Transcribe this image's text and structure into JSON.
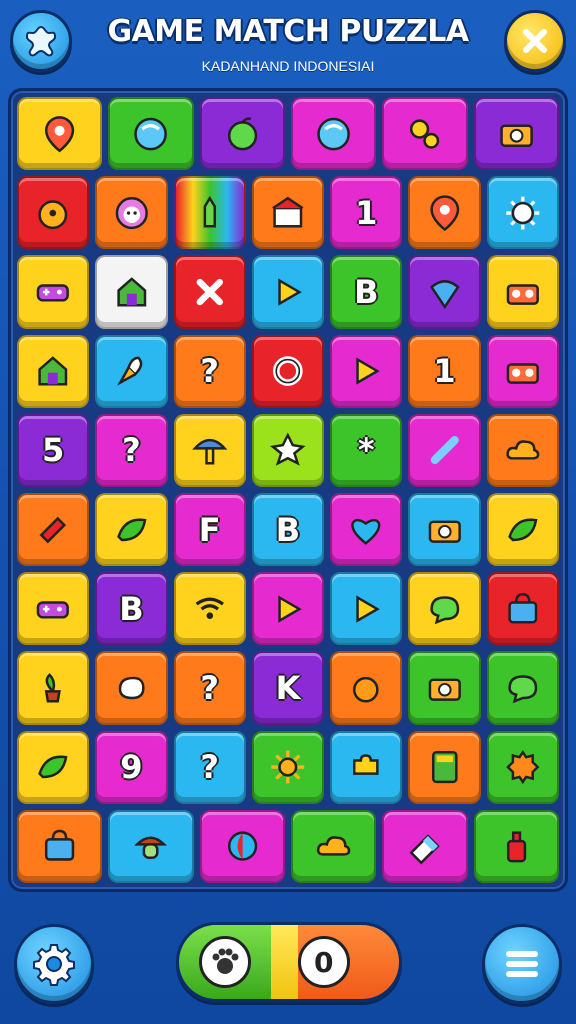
{
  "header": {
    "title": "GAME MATCH PUZZLA",
    "subtitle": "KADANHAND INDONESIAI",
    "left_button_icon": "star-puzzle-icon",
    "right_button_icon": "close-icon"
  },
  "colors": {
    "background": "#1552b0",
    "board": "#173a82",
    "yellow": "#ffd21e",
    "green": "#3cc42a",
    "purple": "#8a2bd6",
    "magenta": "#e52bd0",
    "red": "#e8232a",
    "orange": "#ff7a1a",
    "cyan": "#2bb8f0",
    "lime": "#9be21d",
    "white": "#f4f4f4"
  },
  "board": {
    "rows": [
      [
        {
          "color": "yellow",
          "icon": "location-pin-icon"
        },
        {
          "color": "green",
          "icon": "blue-ball-icon"
        },
        {
          "color": "purple",
          "icon": "green-apple-icon"
        },
        {
          "color": "magenta",
          "icon": "blue-ball-icon"
        },
        {
          "color": "magenta",
          "icon": "key-ring-icon"
        },
        {
          "color": "purple",
          "icon": "camera-icon"
        }
      ],
      [
        {
          "color": "red",
          "icon": "orange-monster-icon"
        },
        {
          "color": "orange",
          "icon": "flower-face-icon"
        },
        {
          "color": "rainbow",
          "icon": "pencil-icon"
        },
        {
          "color": "orange",
          "icon": "shop-icon"
        },
        {
          "color": "magenta",
          "icon": "letter-icon",
          "glyph": "1"
        },
        {
          "color": "orange",
          "icon": "location-pin-icon"
        },
        {
          "color": "cyan",
          "icon": "sun-face-icon"
        }
      ],
      [
        {
          "color": "yellow",
          "icon": "gamepad-icon"
        },
        {
          "color": "white",
          "icon": "house-icon"
        },
        {
          "color": "red",
          "icon": "close-icon"
        },
        {
          "color": "cyan",
          "icon": "play-icon"
        },
        {
          "color": "green",
          "icon": "letter-icon",
          "glyph": "B"
        },
        {
          "color": "purple",
          "icon": "spinning-top-icon"
        },
        {
          "color": "yellow",
          "icon": "radio-icon"
        }
      ],
      [
        {
          "color": "yellow",
          "icon": "house-icon"
        },
        {
          "color": "cyan",
          "icon": "rocket-icon"
        },
        {
          "color": "orange",
          "icon": "question-icon",
          "glyph": "?"
        },
        {
          "color": "red",
          "icon": "ring-icon"
        },
        {
          "color": "magenta",
          "icon": "play-icon"
        },
        {
          "color": "orange",
          "icon": "letter-icon",
          "glyph": "1"
        },
        {
          "color": "magenta",
          "icon": "radio-icon"
        }
      ],
      [
        {
          "color": "purple",
          "icon": "number-icon",
          "glyph": "5"
        },
        {
          "color": "magenta",
          "icon": "question-icon",
          "glyph": "?"
        },
        {
          "color": "yellow",
          "icon": "mushroom-icon"
        },
        {
          "color": "lime",
          "icon": "puzzle-star-icon"
        },
        {
          "color": "green",
          "icon": "asterisk-icon",
          "glyph": "*"
        },
        {
          "color": "magenta",
          "icon": "stick-icon"
        },
        {
          "color": "orange",
          "icon": "cloud-icon"
        }
      ],
      [
        {
          "color": "orange",
          "icon": "bandage-icon"
        },
        {
          "color": "yellow",
          "icon": "leaf-icon"
        },
        {
          "color": "magenta",
          "icon": "letter-icon",
          "glyph": "F"
        },
        {
          "color": "cyan",
          "icon": "letter-icon",
          "glyph": "B"
        },
        {
          "color": "magenta",
          "icon": "heart-icon"
        },
        {
          "color": "cyan",
          "icon": "camera-icon"
        },
        {
          "color": "yellow",
          "icon": "leaf-icon"
        }
      ],
      [
        {
          "color": "yellow",
          "icon": "gamepad-icon"
        },
        {
          "color": "purple",
          "icon": "letter-icon",
          "glyph": "B"
        },
        {
          "color": "yellow",
          "icon": "wifi-icon"
        },
        {
          "color": "magenta",
          "icon": "play-icon"
        },
        {
          "color": "cyan",
          "icon": "play-icon"
        },
        {
          "color": "yellow",
          "icon": "chat-icon"
        },
        {
          "color": "red",
          "icon": "bag-icon"
        }
      ],
      [
        {
          "color": "yellow",
          "icon": "plant-icon"
        },
        {
          "color": "orange",
          "icon": "stone-icon"
        },
        {
          "color": "orange",
          "icon": "question-icon",
          "glyph": "?"
        },
        {
          "color": "purple",
          "icon": "letter-icon",
          "glyph": "K"
        },
        {
          "color": "orange",
          "icon": "orange-fruit-icon"
        },
        {
          "color": "green",
          "icon": "camera-icon"
        },
        {
          "color": "green",
          "icon": "chat-icon"
        }
      ],
      [
        {
          "color": "yellow",
          "icon": "leaf-icon"
        },
        {
          "color": "magenta",
          "icon": "letter-icon",
          "glyph": "9"
        },
        {
          "color": "cyan",
          "icon": "question-icon",
          "glyph": "?"
        },
        {
          "color": "green",
          "icon": "sun-icon"
        },
        {
          "color": "cyan",
          "icon": "puzzle-piece-icon"
        },
        {
          "color": "orange",
          "icon": "calculator-icon"
        },
        {
          "color": "green",
          "icon": "sun-blob-icon"
        }
      ],
      [
        {
          "color": "orange",
          "icon": "bag-icon"
        },
        {
          "color": "cyan",
          "icon": "mushroom-face-icon"
        },
        {
          "color": "magenta",
          "icon": "beach-ball-icon"
        },
        {
          "color": "green",
          "icon": "cloud-icon"
        },
        {
          "color": "magenta",
          "icon": "eraser-icon"
        },
        {
          "color": "green",
          "icon": "bottle-icon"
        }
      ]
    ]
  },
  "footer": {
    "settings_icon": "gear-icon",
    "menu_icon": "menu-icon",
    "toggle_left_icon": "paw-icon",
    "toggle_right_glyph": "0"
  }
}
